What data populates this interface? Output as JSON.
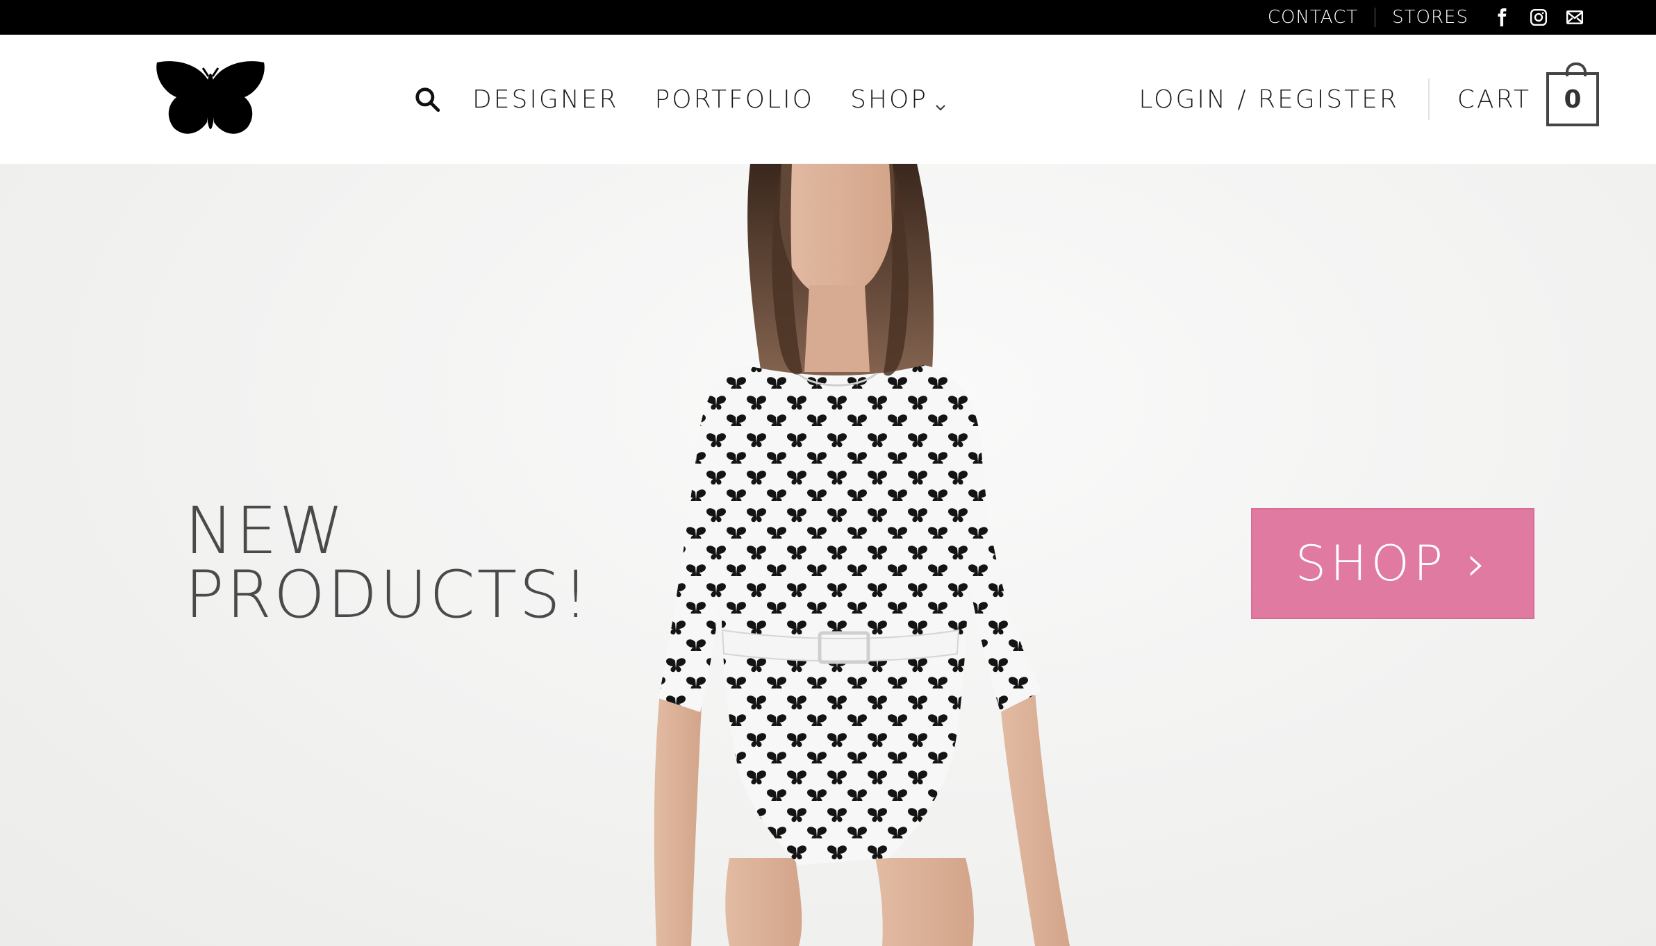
{
  "topbar": {
    "contact": "CONTACT",
    "stores": "STORES",
    "icons": [
      "facebook-icon",
      "instagram-icon",
      "email-icon"
    ]
  },
  "header": {
    "logo_icon": "butterfly-logo-icon",
    "search_icon": "search-icon",
    "nav": {
      "designer": "DESIGNER",
      "portfolio": "PORTFOLIO",
      "shop": "SHOP"
    },
    "login": "LOGIN / REGISTER",
    "cart_label": "CART",
    "cart_count": "0"
  },
  "hero": {
    "headline_line1": "NEW",
    "headline_line2": "PRODUCTS!",
    "cta": "SHOP ›",
    "image": "model-in-butterfly-print-bodysuit"
  },
  "colors": {
    "topbar_bg": "#000000",
    "cta_bg": "#e07aa0",
    "headline": "#4a4a4a",
    "nav_text": "#1a1a1a"
  }
}
